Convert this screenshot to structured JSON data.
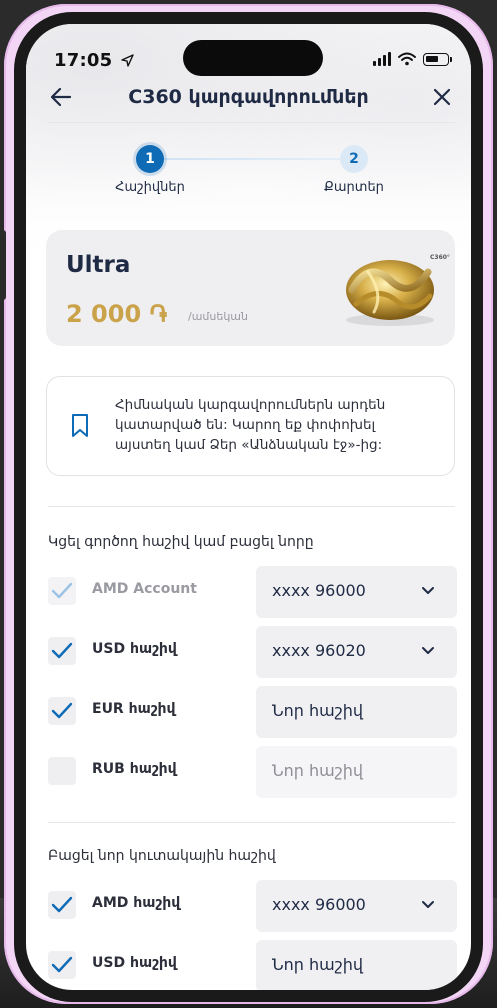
{
  "status": {
    "time": "17:05"
  },
  "nav": {
    "title": "C360 կարգավորումներ"
  },
  "stepper": {
    "steps": [
      {
        "number": "1",
        "label": "Հաշիվներ",
        "state": "active"
      },
      {
        "number": "2",
        "label": "Քարտեր",
        "state": "inactive"
      }
    ]
  },
  "card": {
    "name": "Ultra",
    "price": "2 000 ֏",
    "unit": "/ամսեկան",
    "logo_text": "C360°"
  },
  "notice": {
    "icon": "bookmark-icon",
    "text": "Հիմնական կարգավորումներն արդեն կատարված են: Կարող եք փոփոխել այստեղ կամ Ձեր «Անձնական էջ»-ից:"
  },
  "section1": {
    "title": "Կցել գործող հաշիվ կամ բացել նորը",
    "rows": [
      {
        "label": "AMD Account",
        "checked": true,
        "disabled": true,
        "value": "xxxx 96000",
        "dropdown": true
      },
      {
        "label": "USD հաշիվ",
        "checked": true,
        "disabled": false,
        "value": "xxxx 96020",
        "dropdown": true
      },
      {
        "label": "EUR հաշիվ",
        "checked": true,
        "disabled": false,
        "value": "Նոր հաշիվ",
        "dropdown": false
      },
      {
        "label": "RUB հաշիվ",
        "checked": false,
        "disabled": false,
        "value": "Նոր հաշիվ",
        "dropdown": false
      }
    ]
  },
  "section2": {
    "title": "Բացել նոր կուտակային հաշիվ",
    "rows": [
      {
        "label": "AMD հաշիվ",
        "checked": true,
        "disabled": false,
        "value": "xxxx 96000",
        "dropdown": true
      },
      {
        "label": "USD հաշիվ",
        "checked": true,
        "disabled": false,
        "value": "Նոր հաշիվ",
        "dropdown": false
      }
    ]
  },
  "colors": {
    "primary": "#0f6bb5",
    "gold": "#c9a24a",
    "text": "#1f2a44"
  }
}
